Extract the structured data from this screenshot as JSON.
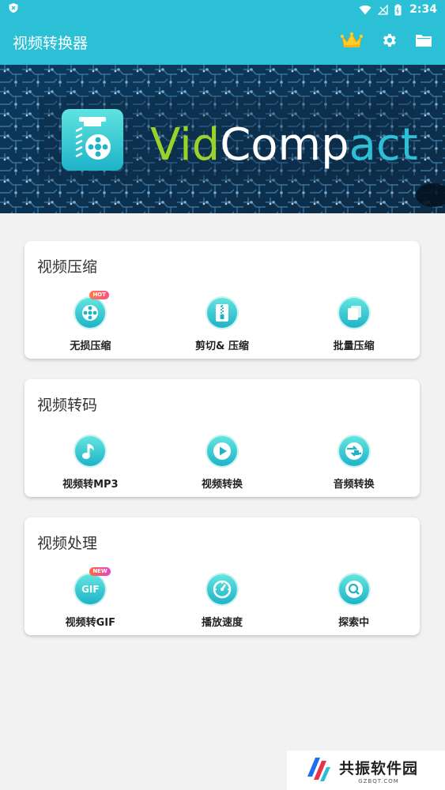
{
  "status_bar": {
    "time": "2:34"
  },
  "app_bar": {
    "title": "视频转换器",
    "icons": [
      "crown-icon",
      "gear-icon",
      "folder-icon"
    ]
  },
  "banner": {
    "brand_part1": "Vid",
    "brand_part2": "Comp",
    "brand_part3": "act"
  },
  "sections": [
    {
      "title": "视频压缩",
      "items": [
        {
          "label": "无损压缩",
          "icon": "film-reel-icon",
          "badge": "HOT"
        },
        {
          "label": "剪切& 压缩",
          "icon": "zip-file-icon"
        },
        {
          "label": "批量压缩",
          "icon": "stacked-pages-icon"
        }
      ]
    },
    {
      "title": "视频转码",
      "items": [
        {
          "label": "视频转MP3",
          "icon": "music-note-icon"
        },
        {
          "label": "视频转换",
          "icon": "play-icon"
        },
        {
          "label": "音频转换",
          "icon": "audio-convert-icon"
        }
      ]
    },
    {
      "title": "视频处理",
      "items": [
        {
          "label": "视频转GIF",
          "icon": "gif-icon",
          "badge": "NEW",
          "icon_text": "GIF"
        },
        {
          "label": "播放速度",
          "icon": "speedometer-icon"
        },
        {
          "label": "探索中",
          "icon": "magnifier-icon"
        }
      ]
    }
  ],
  "watermark": {
    "main": "共振软件园",
    "sub": "GZBQT.COM"
  },
  "colors": {
    "primary": "#2bc0d6",
    "icon_gradient_top": "#63e5df",
    "icon_gradient_bottom": "#1eb3c8",
    "brand_green": "#9bd22a"
  }
}
